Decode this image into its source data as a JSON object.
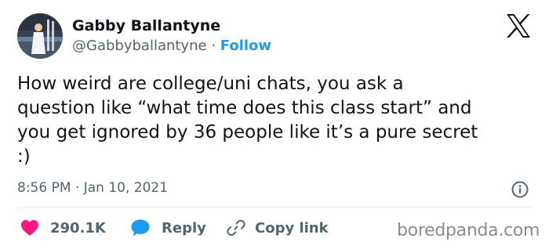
{
  "author": {
    "name": "Gabby Ballantyne",
    "handle": "@Gabbyballantyne",
    "separator": "·",
    "follow_label": "Follow"
  },
  "tweet": {
    "lines": [
      "How weird are college/uni chats, you ask a",
      "question like “what time does this class start” and",
      "you get ignored by 36 people like it’s a pure secret",
      ":)"
    ],
    "timestamp": "8:56 PM · Jan 10, 2021"
  },
  "actions": {
    "likes": "290.1K",
    "reply_label": "Reply",
    "copy_label": "Copy link"
  },
  "watermark": "boredpanda.com",
  "colors": {
    "accent": "#1d9bf0",
    "like": "#f91880",
    "text": "#0f1419",
    "muted": "#536471"
  },
  "icons": [
    "x-logo-icon",
    "info-icon",
    "heart-icon",
    "reply-bubble-icon",
    "link-icon"
  ]
}
